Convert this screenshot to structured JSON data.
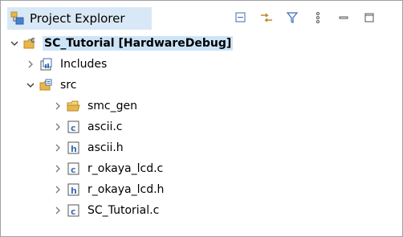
{
  "panel": {
    "title": "Project Explorer",
    "toolbar": [
      {
        "name": "collapse-all-icon"
      },
      {
        "name": "link-with-editor-icon"
      },
      {
        "name": "filter-icon"
      },
      {
        "name": "view-menu-icon"
      },
      {
        "name": "minimize-icon"
      },
      {
        "name": "maximize-icon"
      }
    ]
  },
  "tree": [
    {
      "label": "SC_Tutorial [HardwareDebug]",
      "level": 0,
      "expanded": true,
      "icon": "project-icon",
      "bold": true,
      "selected": true
    },
    {
      "label": "Includes",
      "level": 1,
      "expanded": false,
      "icon": "includes-icon"
    },
    {
      "label": "src",
      "level": 1,
      "expanded": true,
      "icon": "source-folder-icon"
    },
    {
      "label": "smc_gen",
      "level": 2,
      "expanded": false,
      "icon": "folder-icon"
    },
    {
      "label": "ascii.c",
      "level": 2,
      "expanded": false,
      "icon": "c-file-icon"
    },
    {
      "label": "ascii.h",
      "level": 2,
      "expanded": false,
      "icon": "h-file-icon"
    },
    {
      "label": "r_okaya_lcd.c",
      "level": 2,
      "expanded": false,
      "icon": "c-file-icon"
    },
    {
      "label": "r_okaya_lcd.h",
      "level": 2,
      "expanded": false,
      "icon": "h-file-icon"
    },
    {
      "label": "SC_Tutorial.c",
      "level": 2,
      "expanded": false,
      "icon": "c-file-icon"
    }
  ],
  "colors": {
    "tab_bg": "#d9e8f6",
    "selection": "#cce4f7",
    "folder": "#e8b64a",
    "project_blue": "#3c6fb5"
  }
}
